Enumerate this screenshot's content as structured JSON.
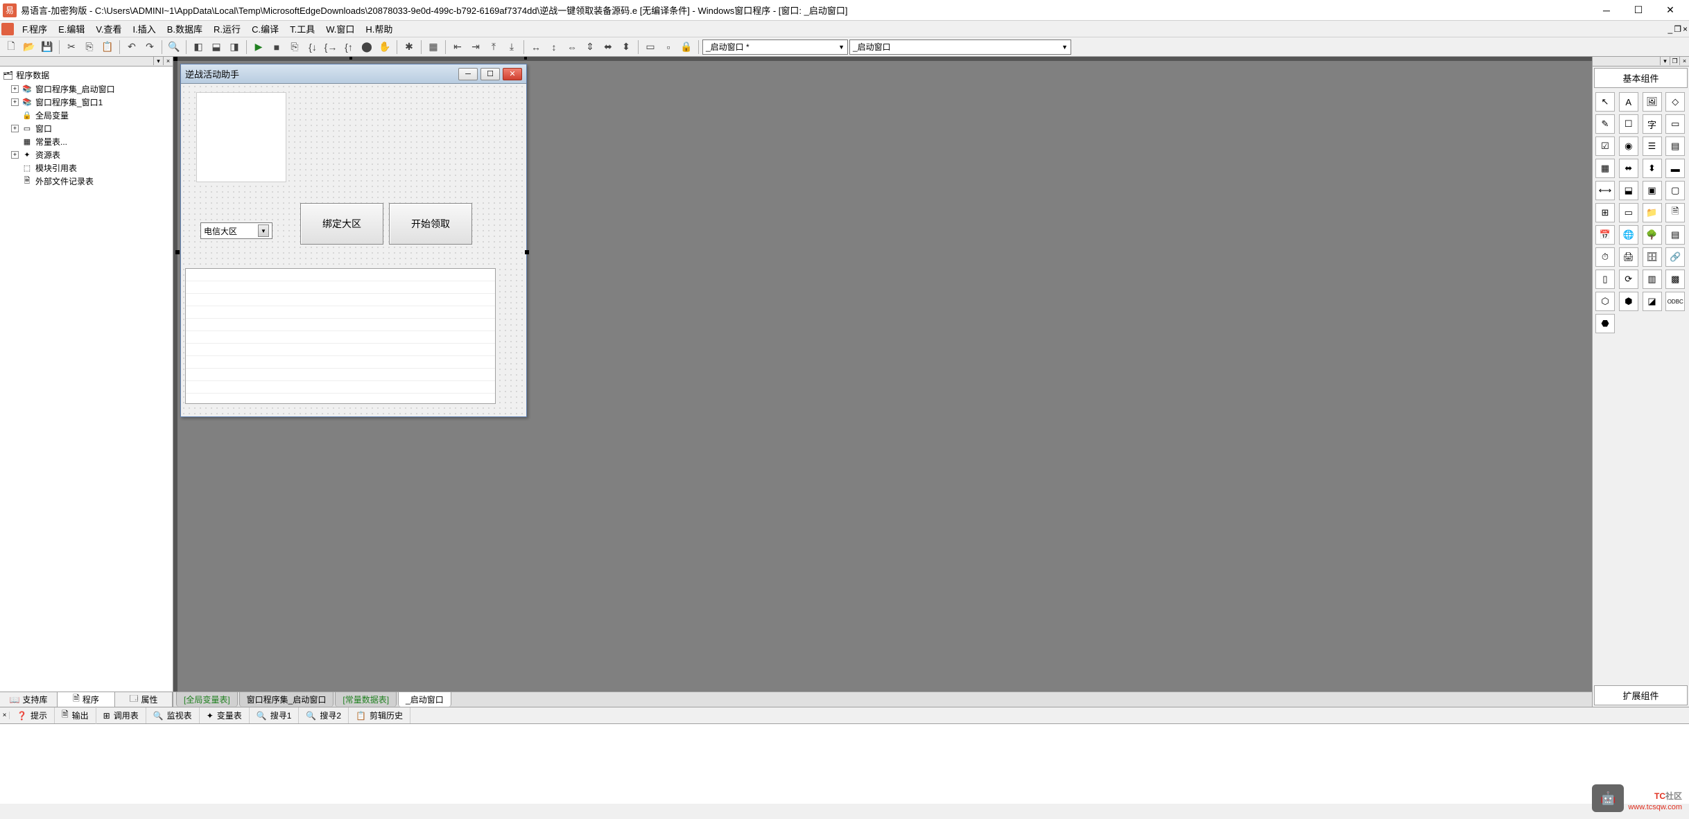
{
  "app_icon_text": "易",
  "title": "易语言-加密狗版 - C:\\Users\\ADMINI~1\\AppData\\Local\\Temp\\MicrosoftEdgeDownloads\\20878033-9e0d-499c-b792-6169af7374dd\\逆战一键领取装备源码.e [无编译条件] - Windows窗口程序 - [窗口: _启动窗口]",
  "menu": {
    "program": "F.程序",
    "edit": "E.编辑",
    "view": "V.查看",
    "insert": "I.插入",
    "database": "B.数据库",
    "run": "R.运行",
    "compile": "C.编译",
    "tools": "T.工具",
    "window": "W.窗口",
    "help": "H.帮助"
  },
  "toolbar_combos": {
    "left": "_启动窗口 *",
    "right": "_启动窗口"
  },
  "tree": {
    "root": "程序数据",
    "items": [
      "窗口程序集_启动窗口",
      "窗口程序集_窗口1",
      "全局变量",
      "窗口",
      "常量表...",
      "资源表",
      "模块引用表",
      "外部文件记录表"
    ]
  },
  "left_tabs": {
    "support": "支持库",
    "program": "程序",
    "property": "属性"
  },
  "design_form": {
    "title": "逆战活动助手",
    "combo_value": "电信大区",
    "button1": "绑定大区",
    "button2": "开始领取"
  },
  "center_tabs": {
    "global_vars": "[全局变量表]",
    "window_set": "窗口程序集_启动窗口",
    "const_table": "[常量数据表]",
    "startup_window": "_启动窗口"
  },
  "right_panel": {
    "basic_components": "基本组件",
    "extended_components": "扩展组件"
  },
  "bottom_tabs": {
    "tips": "提示",
    "output": "输出",
    "calltable": "调用表",
    "watch": "监视表",
    "vars": "变量表",
    "search1": "搜寻1",
    "search2": "搜寻2",
    "clipboard": "剪辑历史"
  },
  "watermark": {
    "text_tc": "TC",
    "text_community": "社区",
    "url": "www.tcsqw.com"
  }
}
